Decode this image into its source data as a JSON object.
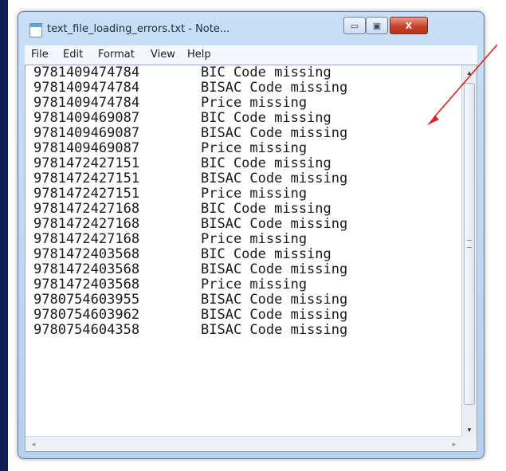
{
  "window": {
    "title": "text_file_loading_errors.txt - Note...",
    "min_glyph": "▭",
    "max_glyph": "▣",
    "close_glyph": "X"
  },
  "menu": [
    "File",
    "Edit",
    "Format",
    "View",
    "Help"
  ],
  "rows": [
    [
      "9781409474784",
      "BIC Code missing"
    ],
    [
      "9781409474784",
      "BISAC Code missing"
    ],
    [
      "9781409474784",
      "Price missing"
    ],
    [
      "9781409469087",
      "BIC Code missing"
    ],
    [
      "9781409469087",
      "BISAC Code missing"
    ],
    [
      "9781409469087",
      "Price missing"
    ],
    [
      "9781472427151",
      "BIC Code missing"
    ],
    [
      "9781472427151",
      "BISAC Code missing"
    ],
    [
      "9781472427151",
      "Price missing"
    ],
    [
      "9781472427168",
      "BIC Code missing"
    ],
    [
      "9781472427168",
      "BISAC Code missing"
    ],
    [
      "9781472427168",
      "Price missing"
    ],
    [
      "9781472403568",
      "BIC Code missing"
    ],
    [
      "9781472403568",
      "BISAC Code missing"
    ],
    [
      "9781472403568",
      "Price missing"
    ],
    [
      "9780754603955",
      "BISAC Code missing"
    ],
    [
      "9780754603962",
      "BISAC Code missing"
    ],
    [
      "9780754604358",
      "BISAC Code missing"
    ]
  ],
  "colors": {
    "arrow": "#e02020",
    "slide_bg": "#1f3f8f"
  },
  "icons": {
    "scroll_up": "▲",
    "scroll_down": "▼",
    "scroll_left": "◄",
    "scroll_right": "►"
  }
}
